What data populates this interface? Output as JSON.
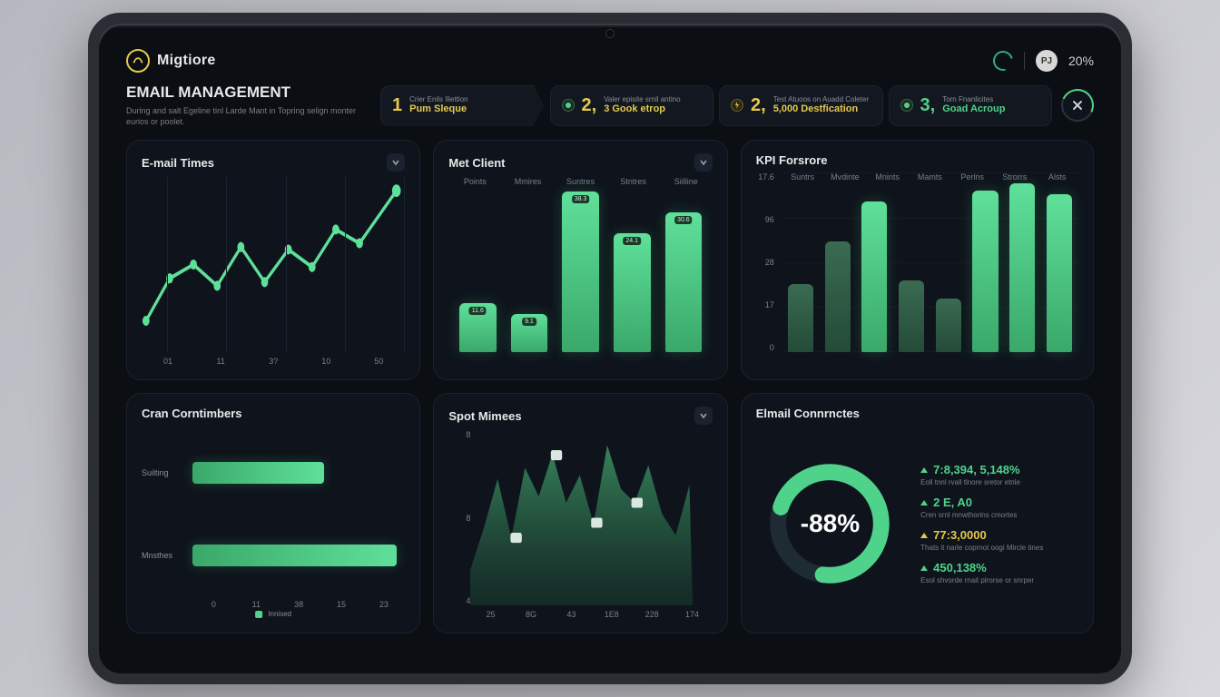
{
  "brand": {
    "name": "Migtiore"
  },
  "header": {
    "avatar_initials": "PJ",
    "top_percent": "20%"
  },
  "title": {
    "heading": "EMAIL MANAGEMENT",
    "subtitle": "During and salt Egeline tinl Larde Mant in Topring selign monter eurios or poolet."
  },
  "steps": [
    {
      "num": "1",
      "top": "Crier Enils Iliettion",
      "main": "Pum Sleque",
      "main_color": "yellow",
      "icon": "yellow"
    },
    {
      "num": "2,",
      "top": "Valer episite srnil antino",
      "main": "3 Gook etrop",
      "main_color": "yellow",
      "icon": "green"
    },
    {
      "num": "2,",
      "top": "Test Atuoos on Auadd Coleter",
      "main": "5,000 Destfication",
      "main_color": "yellow",
      "icon": "yellow"
    },
    {
      "num": "3,",
      "top": "Torn Fnanlicites",
      "main": "Goad Acroup",
      "main_color": "green",
      "icon": "green"
    }
  ],
  "cards": {
    "email_times": {
      "title": "E-mail Times",
      "x": [
        "01",
        "11",
        "3?",
        "10",
        "50"
      ]
    },
    "met_client": {
      "title": "Met Client",
      "x": [
        "Points",
        "Mmires",
        "Suntres",
        "Stntres",
        "Siilline"
      ]
    },
    "kpi": {
      "title": "KPI Forsrore",
      "y": [
        "17.6",
        "96",
        "28",
        "17",
        "0"
      ],
      "x": [
        "Suntrs",
        "Mvdinte",
        "Mnints",
        "Mamts",
        "Perlns",
        "Strorrs",
        "Alsts"
      ]
    },
    "cran": {
      "title": "Cran Corntimbers",
      "rows": [
        "Suilting",
        "Mnsthes"
      ],
      "x": [
        "0",
        "11",
        "38",
        "15",
        "23"
      ],
      "legend": "Innised"
    },
    "spot": {
      "title": "Spot Mimees",
      "y": [
        "8",
        "8",
        "4"
      ],
      "x": [
        "25",
        "8G",
        "43",
        "1E8",
        "228",
        "174"
      ]
    },
    "conn": {
      "title": "Elmail Connrnctes",
      "center": "-88%",
      "stats": [
        {
          "color": "green",
          "val": "7:8,394, 5,148%",
          "sub": "Eoll tnnl rvall tlnore sretor etnle"
        },
        {
          "color": "green",
          "val": "2 E, A0",
          "sub": "Cren srnl mnwthorins cmortes"
        },
        {
          "color": "yellow",
          "val": "77:3,0000",
          "sub": "Thats it narle coprnot oogi Mircle tines"
        },
        {
          "color": "green",
          "val": "450,138%",
          "sub": "Esol shvorde rnait plrorse or snrper"
        }
      ]
    }
  },
  "chart_data": [
    {
      "id": "email_times",
      "type": "line",
      "title": "E-mail Times",
      "x_labels": [
        "01",
        "11",
        "3?",
        "10",
        "50"
      ],
      "values": [
        18,
        42,
        50,
        38,
        60,
        40,
        58,
        48,
        70,
        62,
        92
      ],
      "ylim": [
        0,
        100
      ]
    },
    {
      "id": "met_client",
      "type": "bar",
      "title": "Met Client",
      "categories": [
        "Points",
        "Mmires",
        "Suntres",
        "Stntres",
        "Siilline"
      ],
      "values": [
        28,
        22,
        92,
        68,
        80
      ],
      "ylim": [
        0,
        100
      ]
    },
    {
      "id": "kpi_forsrore",
      "type": "bar",
      "title": "KPI Forsrore",
      "categories": [
        "Suntrs",
        "Mvdinte",
        "Mnints",
        "Mamts",
        "Perlns",
        "Strorrs",
        "Alsts"
      ],
      "values": [
        38,
        62,
        84,
        40,
        30,
        90,
        94,
        88
      ],
      "ylim": [
        0,
        100
      ],
      "y_ticks": [
        "17.6",
        "96",
        "28",
        "17",
        "0"
      ]
    },
    {
      "id": "cran_corntimbers",
      "type": "bar_horizontal",
      "title": "Cran Corntimbers",
      "categories": [
        "Suilting",
        "Mnsthes"
      ],
      "values": [
        62,
        96
      ],
      "xlim": [
        0,
        100
      ],
      "x_ticks": [
        "0",
        "11",
        "38",
        "15",
        "23"
      ],
      "legend": [
        "Innised"
      ]
    },
    {
      "id": "spot_mimees",
      "type": "area",
      "title": "Spot Mimees",
      "x_labels": [
        "25",
        "8G",
        "43",
        "1E8",
        "228",
        "174"
      ],
      "values": [
        20,
        44,
        72,
        38,
        78,
        62,
        86,
        58,
        74,
        46,
        90,
        66,
        58,
        80,
        52,
        40,
        68
      ],
      "ylim": [
        0,
        100
      ],
      "y_ticks": [
        "8",
        "8",
        "4"
      ]
    },
    {
      "id": "email_connrnctes",
      "type": "donut",
      "title": "Elmail Connrnctes",
      "center_label": "-88%",
      "segments": [
        {
          "name": "filled",
          "value": 72,
          "color": "#4fd38a"
        },
        {
          "name": "empty",
          "value": 28,
          "color": "#1e2a34"
        }
      ]
    }
  ]
}
